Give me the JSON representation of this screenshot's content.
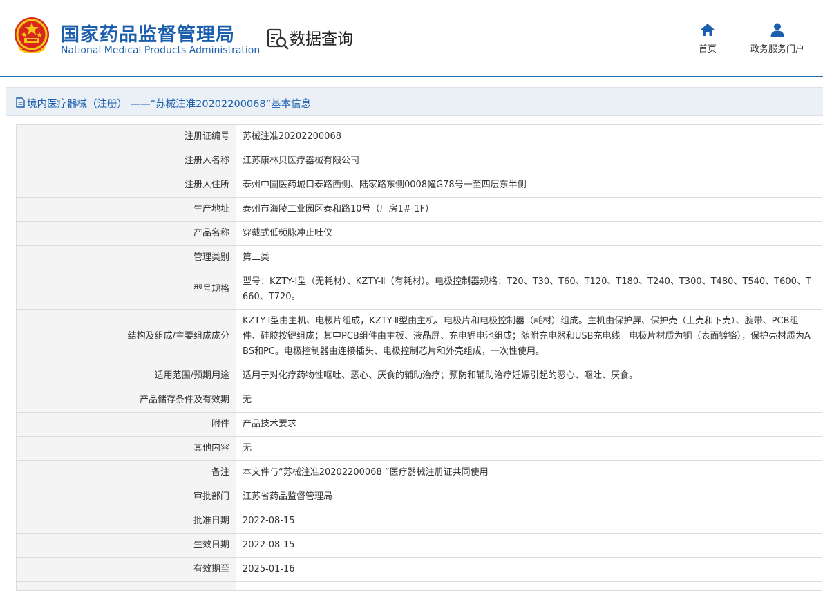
{
  "header": {
    "site_name_cn": "国家药品监督管理局",
    "site_name_en": "National Medical Products Administration",
    "query_title": "数据查询",
    "nav": [
      {
        "label": "首页",
        "icon": "home-icon"
      },
      {
        "label": "政务服务门户",
        "icon": "user-icon"
      }
    ]
  },
  "colors": {
    "brand": "#1b5fae",
    "header_line": "#1f6fb5",
    "panel_head_bg": "#eaf0f6",
    "label_bg": "#f4f4f4"
  },
  "panel": {
    "title": "境内医疗器械（注册） ——“苏械注准20202200068”基本信息",
    "title_icon": "document-icon"
  },
  "rows": [
    {
      "label": "注册证编号",
      "value": "苏械注准20202200068"
    },
    {
      "label": "注册人名称",
      "value": "江苏康林贝医疗器械有限公司"
    },
    {
      "label": "注册人住所",
      "value": "泰州中国医药城口泰路西侧、陆家路东侧0008幢G78号一至四层东半侧"
    },
    {
      "label": "生产地址",
      "value": "泰州市海陵工业园区泰和路10号（厂房1#-1F）"
    },
    {
      "label": "产品名称",
      "value": "穿戴式低频脉冲止吐仪"
    },
    {
      "label": "管理类别",
      "value": "第二类"
    },
    {
      "label": "型号规格",
      "value": "型号：KZTY-Ⅰ型（无耗材）、KZTY-Ⅱ（有耗材）。电极控制器规格：T20、T30、T60、T120、T180、T240、T300、T480、T540、T600、T660、T720。"
    },
    {
      "label": "结构及组成/主要组成成分",
      "value": "KZTY-Ⅰ型由主机、电极片组成，KZTY-Ⅱ型由主机、电极片和电极控制器（耗材）组成。主机由保护屏、保护壳（上壳和下壳）、腕带、PCB组件、硅胶按键组成；其中PCB组件由主板、液晶屏、充电锂电池组成；随附充电器和USB充电线。电极片材质为铜（表面镀铬），保护壳材质为ABS和PC。电极控制器由连接插头、电极控制芯片和外壳组成，一次性使用。"
    },
    {
      "label": "适用范围/预期用途",
      "value": "适用于对化疗药物性呕吐、恶心、厌食的辅助治疗；预防和辅助治疗妊娠引起的恶心、呕吐、厌食。"
    },
    {
      "label": "产品储存条件及有效期",
      "value": "无"
    },
    {
      "label": "附件",
      "value": "产品技术要求"
    },
    {
      "label": "其他内容",
      "value": "无"
    },
    {
      "label": "备注",
      "value": "本文件与“苏械注准20202200068 ”医疗器械注册证共同使用"
    },
    {
      "label": "审批部门",
      "value": "江苏省药品监督管理局"
    },
    {
      "label": "批准日期",
      "value": "2022-08-15"
    },
    {
      "label": "生效日期",
      "value": "2022-08-15"
    },
    {
      "label": "有效期至",
      "value": "2025-01-16"
    },
    {
      "label": "",
      "value": ""
    }
  ]
}
